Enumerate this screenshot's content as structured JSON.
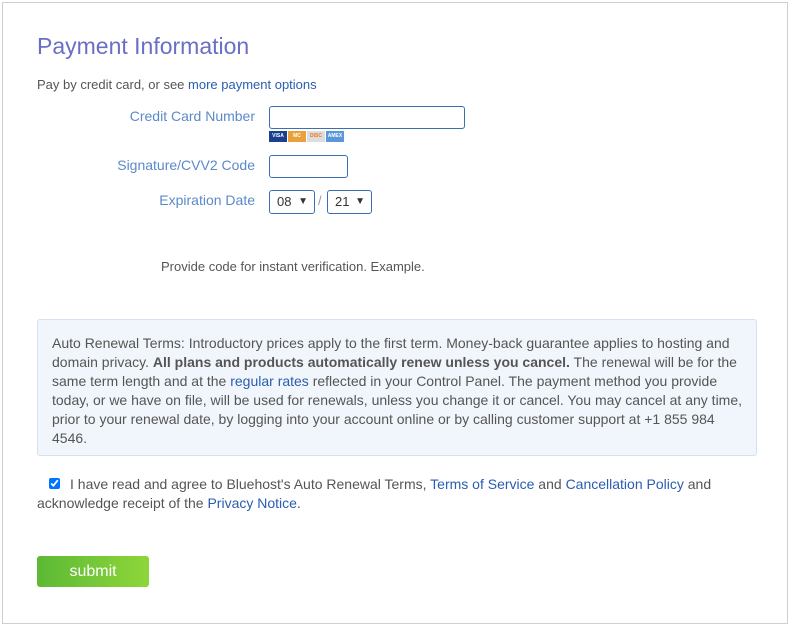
{
  "title": "Payment Information",
  "subtitle": {
    "prefix": "Pay by credit card, or see ",
    "link": "more payment options"
  },
  "form": {
    "card_number_label": "Credit Card Number",
    "card_number_value": "",
    "card_brands": [
      "VISA",
      "MC",
      "DISC",
      "AMEX"
    ],
    "cvv_label": "Signature/CVV2 Code",
    "cvv_value": "",
    "expiration_label": "Expiration Date",
    "exp_month": "08",
    "exp_separator": "/",
    "exp_year": "21",
    "verification_note": "Provide code for instant verification. Example."
  },
  "terms": {
    "t1": "Auto Renewal Terms: Introductory prices apply to the first term. Money-back guarantee applies to hosting and domain privacy. ",
    "bold": "All plans and products automatically renew unless you cancel.",
    "t2": " The renewal will be for the same term length and at the ",
    "link": "regular rates",
    "t3": " reflected in your Control Panel. The payment method you provide today, or we have on file, will be used for renewals, unless you change it or cancel. You may cancel at any time, prior to your renewal date, by logging into your account online or by calling customer support at +1 855 984 4546."
  },
  "agree": {
    "checked": true,
    "t1": "I have read and agree to Bluehost's Auto Renewal Terms, ",
    "tos": "Terms of Service",
    "and": " and ",
    "cancel": "Cancellation Policy",
    "t2": " and acknowledge receipt of the ",
    "privacy": "Privacy Notice",
    "end": "."
  },
  "submit_label": "submit"
}
